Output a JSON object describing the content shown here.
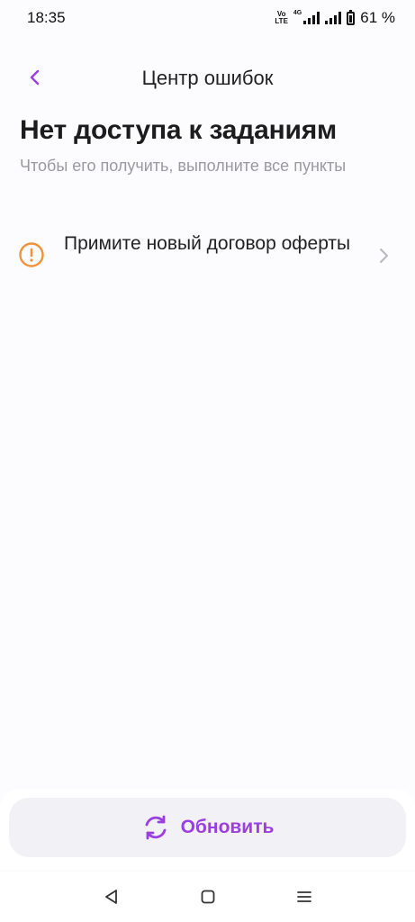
{
  "status_bar": {
    "time": "18:35",
    "volte_top": "Vo",
    "volte_bottom": "LTE",
    "network": "4G",
    "battery": "61 %"
  },
  "header": {
    "title": "Центр ошибок"
  },
  "section": {
    "heading": "Нет доступа к заданиям",
    "subtitle": "Чтобы его получить, выполните все пункты"
  },
  "tasks": [
    {
      "label": "Примите новый договор оферты"
    }
  ],
  "refresh_button": {
    "label": "Обновить"
  },
  "colors": {
    "accent": "#9b3fe0",
    "warning": "#f0933a",
    "chevron": "#b8b8bc"
  },
  "icons": {
    "back": "chevron-left-icon",
    "info": "info-circle-icon",
    "task_arrow": "chevron-right-icon",
    "refresh": "refresh-icon",
    "nav_back": "triangle-back-icon",
    "nav_home": "square-home-icon",
    "nav_menu": "menu-lines-icon"
  }
}
